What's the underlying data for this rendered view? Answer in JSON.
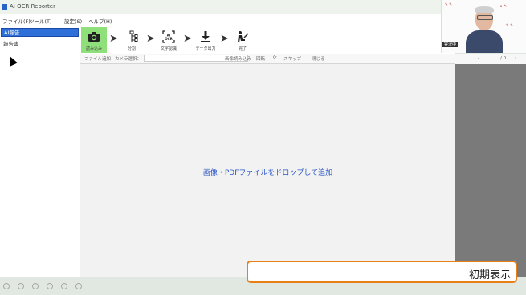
{
  "window": {
    "title": "AI OCR Reporter"
  },
  "menu": [
    "ファイル(F)",
    "ツール(T)",
    "設定(S)",
    "ヘルプ(H)"
  ],
  "sidebar": {
    "items": [
      {
        "label": "AI報告"
      },
      {
        "label": "報告書"
      }
    ]
  },
  "steps": [
    {
      "label": "読み込み",
      "icon": "camera-icon"
    },
    {
      "label": "分割",
      "icon": "split-icon"
    },
    {
      "label": "文字認識",
      "icon": "ai-ocr-icon",
      "icon_text": "AI\nOCR"
    },
    {
      "label": "データ出力",
      "icon": "download-icon"
    },
    {
      "label": "完了",
      "icon": "person-desk-icon"
    }
  ],
  "options": {
    "file_add": "ファイル追加",
    "camera_select": "カメラ選択：",
    "read_image": "画像読み込み",
    "rotate": "回転",
    "skip": "スキップ",
    "extra": "閉じる"
  },
  "page_nav": {
    "prev": "‹",
    "current": "/ 0",
    "next": "›"
  },
  "main": {
    "drop_hint": "画像・PDFファイルをドロップして追加"
  },
  "webcam": {
    "label": "実況中"
  },
  "caption": {
    "text": "初期表示"
  },
  "colors": {
    "accent": "#2f6fd8",
    "active_step": "#8fe07a",
    "caption_border": "#e8801a",
    "hint_text": "#2a56c6"
  }
}
